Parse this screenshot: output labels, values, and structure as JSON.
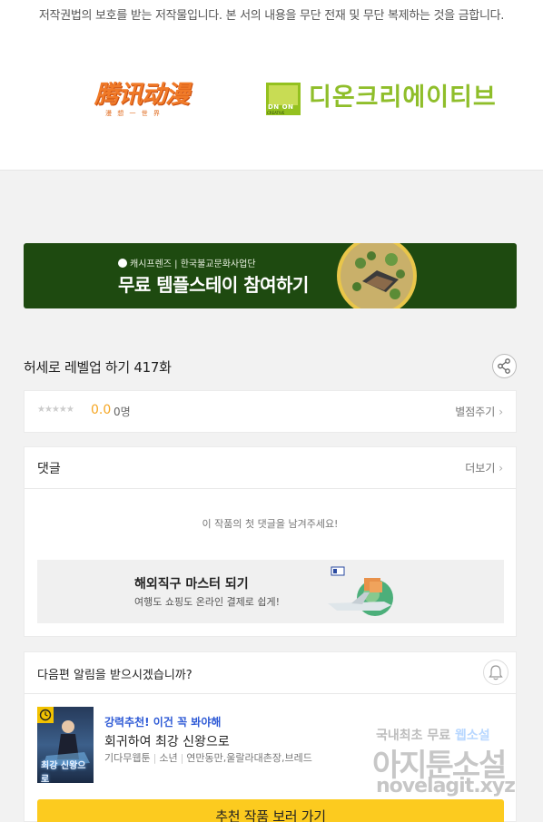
{
  "header": {
    "copyright_text": "저작권법의 보호를 받는 저작물입니다. 본 서의 내용을 무단 전재 및 무단 복제하는 것을 금합니다.",
    "logo_left_text": "腾讯动漫",
    "logo_left_tagline": "漫 想 一 世 界",
    "logo_right_text": "디온크리에이티브",
    "logo_right_badge": "DN ON",
    "logo_right_badge_sub": "CREATIVE"
  },
  "banner": {
    "sponsor": "캐시프렌즈 | 한국불교문화사업단",
    "headline": "무료 템플스테이 참여하기"
  },
  "episode": {
    "title": "허세로 레벨업 하기 417화"
  },
  "rating": {
    "stars": "★★★★★",
    "score": "0.0",
    "count": "0명",
    "rate_link": "별점주기"
  },
  "comments": {
    "title": "댓글",
    "more_link": "더보기",
    "empty_message": "이 작품의 첫 댓글을 남겨주세요!",
    "ad_title": "해외직구 마스터 되기",
    "ad_subtitle": "여행도 쇼핑도 온라인 결제로 쉽게!"
  },
  "next_episode": {
    "prompt": "다음편 알림을 받으시겠습니까?",
    "recommend_tag": "강력추천! 이건 꼭 봐야해",
    "recommend_title": "회귀하여 최강 신왕으로",
    "genre": "기다무웹툰",
    "category": "소년",
    "tags": "연만동만,울랄라대촌장,브레드",
    "cover_text": "최강 신왕으로",
    "cta_label": "추천 작품 보러 가기"
  },
  "watermark": {
    "line1_prefix": "국내최초 무료",
    "line1_highlight": "웹소설",
    "line2": "아지툰소설",
    "line3": "novelagit.xyz"
  },
  "colors": {
    "banner_bg": "#1e4a10",
    "score_color": "#f5a623",
    "cta_bg": "#fccb1f",
    "recommend_tag_color": "#2f5bd6"
  }
}
